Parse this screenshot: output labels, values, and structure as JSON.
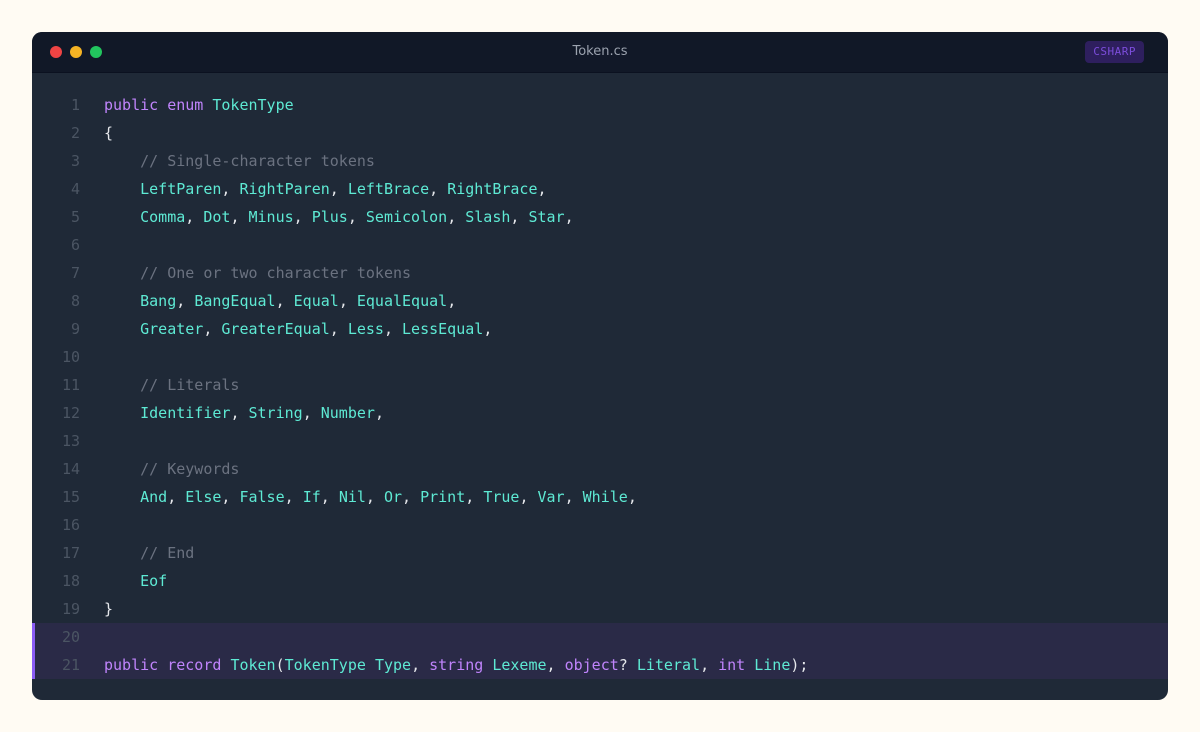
{
  "window": {
    "title": "Token.cs",
    "language_badge": "CSHARP",
    "traffic_lights": [
      {
        "name": "close",
        "color": "#ef4444"
      },
      {
        "name": "minimize",
        "color": "#f5b324"
      },
      {
        "name": "zoom",
        "color": "#22c55e"
      }
    ],
    "badge_color": "#7c4ddb"
  },
  "editor": {
    "highlighted_lines": [
      20,
      21
    ],
    "lines": [
      {
        "n": "1",
        "tokens": [
          [
            "kw",
            "public"
          ],
          [
            "pn",
            " "
          ],
          [
            "kw",
            "enum"
          ],
          [
            "pn",
            " "
          ],
          [
            "ty",
            "TokenType"
          ]
        ]
      },
      {
        "n": "2",
        "tokens": [
          [
            "pn",
            "{"
          ]
        ]
      },
      {
        "n": "3",
        "tokens": [
          [
            "pn",
            "    "
          ],
          [
            "cm",
            "// Single-character tokens"
          ]
        ]
      },
      {
        "n": "4",
        "tokens": [
          [
            "pn",
            "    "
          ],
          [
            "ty",
            "LeftParen"
          ],
          [
            "pn",
            ", "
          ],
          [
            "ty",
            "RightParen"
          ],
          [
            "pn",
            ", "
          ],
          [
            "ty",
            "LeftBrace"
          ],
          [
            "pn",
            ", "
          ],
          [
            "ty",
            "RightBrace"
          ],
          [
            "pn",
            ","
          ]
        ]
      },
      {
        "n": "5",
        "tokens": [
          [
            "pn",
            "    "
          ],
          [
            "ty",
            "Comma"
          ],
          [
            "pn",
            ", "
          ],
          [
            "ty",
            "Dot"
          ],
          [
            "pn",
            ", "
          ],
          [
            "ty",
            "Minus"
          ],
          [
            "pn",
            ", "
          ],
          [
            "ty",
            "Plus"
          ],
          [
            "pn",
            ", "
          ],
          [
            "ty",
            "Semicolon"
          ],
          [
            "pn",
            ", "
          ],
          [
            "ty",
            "Slash"
          ],
          [
            "pn",
            ", "
          ],
          [
            "ty",
            "Star"
          ],
          [
            "pn",
            ","
          ]
        ]
      },
      {
        "n": "6",
        "tokens": []
      },
      {
        "n": "7",
        "tokens": [
          [
            "pn",
            "    "
          ],
          [
            "cm",
            "// One or two character tokens"
          ]
        ]
      },
      {
        "n": "8",
        "tokens": [
          [
            "pn",
            "    "
          ],
          [
            "ty",
            "Bang"
          ],
          [
            "pn",
            ", "
          ],
          [
            "ty",
            "BangEqual"
          ],
          [
            "pn",
            ", "
          ],
          [
            "ty",
            "Equal"
          ],
          [
            "pn",
            ", "
          ],
          [
            "ty",
            "EqualEqual"
          ],
          [
            "pn",
            ","
          ]
        ]
      },
      {
        "n": "9",
        "tokens": [
          [
            "pn",
            "    "
          ],
          [
            "ty",
            "Greater"
          ],
          [
            "pn",
            ", "
          ],
          [
            "ty",
            "GreaterEqual"
          ],
          [
            "pn",
            ", "
          ],
          [
            "ty",
            "Less"
          ],
          [
            "pn",
            ", "
          ],
          [
            "ty",
            "LessEqual"
          ],
          [
            "pn",
            ","
          ]
        ]
      },
      {
        "n": "10",
        "tokens": []
      },
      {
        "n": "11",
        "tokens": [
          [
            "pn",
            "    "
          ],
          [
            "cm",
            "// Literals"
          ]
        ]
      },
      {
        "n": "12",
        "tokens": [
          [
            "pn",
            "    "
          ],
          [
            "ty",
            "Identifier"
          ],
          [
            "pn",
            ", "
          ],
          [
            "ty",
            "String"
          ],
          [
            "pn",
            ", "
          ],
          [
            "ty",
            "Number"
          ],
          [
            "pn",
            ","
          ]
        ]
      },
      {
        "n": "13",
        "tokens": []
      },
      {
        "n": "14",
        "tokens": [
          [
            "pn",
            "    "
          ],
          [
            "cm",
            "// Keywords"
          ]
        ]
      },
      {
        "n": "15",
        "tokens": [
          [
            "pn",
            "    "
          ],
          [
            "ty",
            "And"
          ],
          [
            "pn",
            ", "
          ],
          [
            "ty",
            "Else"
          ],
          [
            "pn",
            ", "
          ],
          [
            "ty",
            "False"
          ],
          [
            "pn",
            ", "
          ],
          [
            "ty",
            "If"
          ],
          [
            "pn",
            ", "
          ],
          [
            "ty",
            "Nil"
          ],
          [
            "pn",
            ", "
          ],
          [
            "ty",
            "Or"
          ],
          [
            "pn",
            ", "
          ],
          [
            "ty",
            "Print"
          ],
          [
            "pn",
            ", "
          ],
          [
            "ty",
            "True"
          ],
          [
            "pn",
            ", "
          ],
          [
            "ty",
            "Var"
          ],
          [
            "pn",
            ", "
          ],
          [
            "ty",
            "While"
          ],
          [
            "pn",
            ","
          ]
        ]
      },
      {
        "n": "16",
        "tokens": []
      },
      {
        "n": "17",
        "tokens": [
          [
            "pn",
            "    "
          ],
          [
            "cm",
            "// End"
          ]
        ]
      },
      {
        "n": "18",
        "tokens": [
          [
            "pn",
            "    "
          ],
          [
            "ty",
            "Eof"
          ]
        ]
      },
      {
        "n": "19",
        "tokens": [
          [
            "pn",
            "}"
          ]
        ]
      },
      {
        "n": "20",
        "tokens": []
      },
      {
        "n": "21",
        "tokens": [
          [
            "kw",
            "public"
          ],
          [
            "pn",
            " "
          ],
          [
            "kw",
            "record"
          ],
          [
            "pn",
            " "
          ],
          [
            "ty",
            "Token"
          ],
          [
            "pn",
            "("
          ],
          [
            "ty",
            "TokenType"
          ],
          [
            "pn",
            " "
          ],
          [
            "ty",
            "Type"
          ],
          [
            "pn",
            ", "
          ],
          [
            "kw",
            "string"
          ],
          [
            "pn",
            " "
          ],
          [
            "ty",
            "Lexeme"
          ],
          [
            "pn",
            ", "
          ],
          [
            "kw",
            "object"
          ],
          [
            "pn",
            "? "
          ],
          [
            "ty",
            "Literal"
          ],
          [
            "pn",
            ", "
          ],
          [
            "kw",
            "int"
          ],
          [
            "pn",
            " "
          ],
          [
            "ty",
            "Line"
          ],
          [
            "pn",
            ");"
          ]
        ]
      }
    ]
  }
}
